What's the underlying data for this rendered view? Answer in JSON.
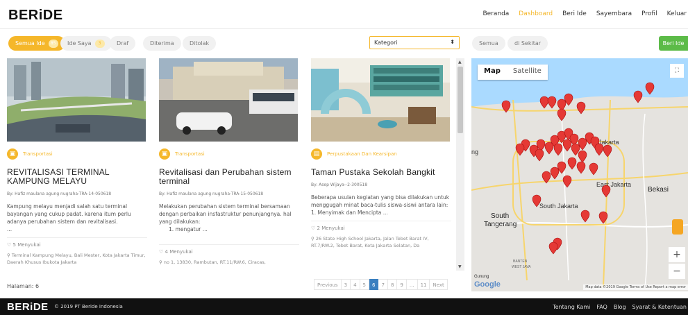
{
  "brand": {
    "logo": "BERiDE"
  },
  "nav": [
    "Beranda",
    "Dashboard",
    "Beri Ide",
    "Sayembara",
    "Profil",
    "Keluar"
  ],
  "filters": {
    "tabs": [
      {
        "label": "Semua Ide",
        "count": "85"
      },
      {
        "label": "Ide Saya",
        "count": "3"
      },
      {
        "label": "Draf"
      },
      {
        "label": "Diterima"
      },
      {
        "label": "Ditolak"
      }
    ],
    "category_select": "Kategori",
    "scope": [
      "Semua",
      "di Sekitar"
    ],
    "submit": "Beri Ide"
  },
  "cards": [
    {
      "category": "Transportasi",
      "title": "REVITALISASI TERMINAL KAMPUNG MELAYU",
      "author": "By: Hafiz maulana agung nugraha-TRA-14-050618",
      "desc": "Kampung melayu menjadi salah satu terminal bayangan yang cukup padat. karena itum perlu adanya perubahan sistem dan revitalisasi.",
      "desc_more": "...",
      "likes": "5 Menyukai",
      "address": "Terminal Kampung Melayu, Bali Mester, Kota Jakarta Timur, Daerah Khusus Ibukota Jakarta"
    },
    {
      "category": "Transportasi",
      "title": "Revitalisasi dan Perubahan sistem terminal",
      "author": "By: Hafiz maulana agung nugraha-TRA-15-050618",
      "desc": "Melakukan perubahan sistem terminal bersamaan dengan perbaikan insfastruktur penunjangnya. hal yang dilakukan:",
      "desc_more": "1. mengatur ...",
      "likes": "4 Menyukai",
      "address": "no 1, 13830, Rambutan, RT.11/RW.6, Ciracas,"
    },
    {
      "category": "Perpustakaan Dan Kearsipan",
      "title": "Taman Pustaka Sekolah Bangkit",
      "author": "By: Asep Wijaya--2-300518",
      "desc": "Beberapa usulan kegiatan yang bisa dilakukan untuk menggugah minat baca-tulis siswa-siswi antara lain:",
      "desc_more": "1. Menyimak dan Mencipta ...",
      "likes": "2 Menyukai",
      "address": "26 State High School Jakarta, Jalan Tebet Barat IV, RT.7/RW.2, Tebet Barat, Kota Jakarta Selatan, Da"
    }
  ],
  "halaman": "Halaman: 6",
  "pagination": [
    "Previous",
    "3",
    "4",
    "5",
    "6",
    "7",
    "8",
    "9",
    "...",
    "11",
    "Next"
  ],
  "pagination_current": "6",
  "map": {
    "tabs": [
      "Map",
      "Satellite"
    ],
    "labels": [
      "rth Jakarta",
      "East Jakarta",
      "Bekasi",
      "South Jakarta",
      "South",
      "Tangerang",
      "ng",
      "BANTEN",
      "WEST JAVA",
      "Gunung"
    ],
    "footer": "Map data ©2019 Google  Terms of Use  Report a map error",
    "google": "Google",
    "zoom_in": "+",
    "zoom_out": "−"
  },
  "footer": {
    "logo": "BERiDE",
    "copyright": "© 2019 PT Beride Indonesia",
    "links": [
      "Tentang Kami",
      "FAQ",
      "Blog",
      "Syarat & Ketentuan"
    ]
  }
}
